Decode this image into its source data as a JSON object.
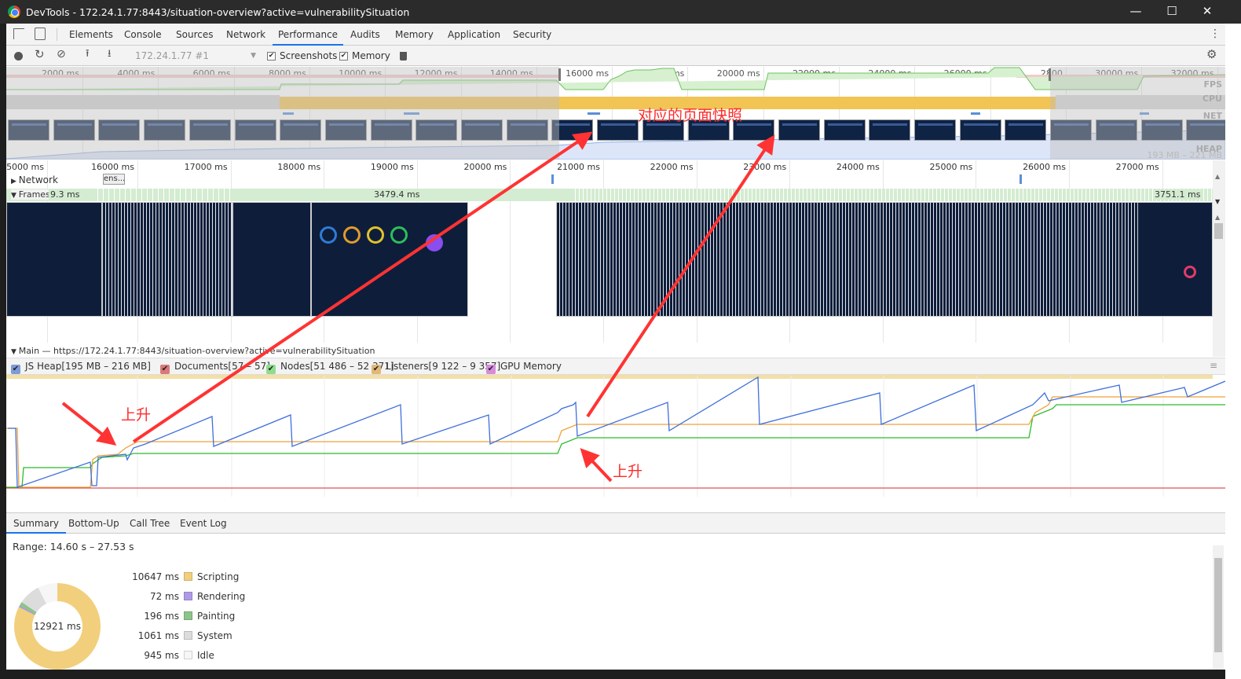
{
  "window": {
    "title": "DevTools - 172.24.1.77:8443/situation-overview?active=vulnerabilitySituation",
    "minimize": "—",
    "maximize": "☐",
    "close": "✕"
  },
  "tabs": [
    "Elements",
    "Console",
    "Sources",
    "Network",
    "Performance",
    "Audits",
    "Memory",
    "Application",
    "Security"
  ],
  "active_tab": "Performance",
  "toolbar": {
    "profile_select": "172.24.1.77 #1",
    "screenshots_label": "Screenshots",
    "screenshots_checked": true,
    "memory_label": "Memory",
    "memory_checked": true
  },
  "overview": {
    "ticks": [
      "2000 ms",
      "4000 ms",
      "6000 ms",
      "8000 ms",
      "10000 ms",
      "12000 ms",
      "14000 ms",
      "16000 ms",
      "18000 ms",
      "20000 ms",
      "22000 ms",
      "24000 ms",
      "26000 ms",
      "2800",
      "30000 ms",
      "32000 ms"
    ],
    "lanes": {
      "fps": "FPS",
      "cpu": "CPU",
      "net": "NET",
      "heap": "HEAP"
    },
    "heap_range": "193 MB – 221 MB"
  },
  "detail": {
    "ticks": [
      "5000 ms",
      "16000 ms",
      "17000 ms",
      "18000 ms",
      "19000 ms",
      "20000 ms",
      "21000 ms",
      "22000 ms",
      "23000 ms",
      "24000 ms",
      "25000 ms",
      "26000 ms",
      "27000 ms"
    ],
    "network_label": "Network",
    "network_item": "ens...",
    "frames_label": "Frames",
    "frames_values": [
      "9.3 ms",
      "3479.4 ms",
      "3751.1 ms"
    ],
    "main_label": "Main — https://172.24.1.77:8443/situation-overview?active=vulnerabilitySituation"
  },
  "memory_legend": [
    {
      "label": "JS Heap[195 MB – 216 MB]",
      "color": "#7d9bd8",
      "line": "#3f6fdc"
    },
    {
      "label": "Documents[57 – 57]",
      "color": "#d97a7a",
      "line": "#d42a2a"
    },
    {
      "label": "Nodes[51 486 – 52 371]",
      "color": "#8fdc8f",
      "line": "#2dbb2d"
    },
    {
      "label": "Listeners[9 122 – 9 357]",
      "color": "#e0b878",
      "line": "#eea23a"
    },
    {
      "label": "GPU Memory",
      "color": "#d78bdb",
      "line": "#b050b8"
    }
  ],
  "bottom_tabs": [
    "Summary",
    "Bottom-Up",
    "Call Tree",
    "Event Log"
  ],
  "summary": {
    "range": "Range: 14.60 s – 27.53 s",
    "total": "12921 ms",
    "items": [
      {
        "value": "10647 ms",
        "ms": 10647,
        "label": "Scripting",
        "color": "#f2cf7c"
      },
      {
        "value": "72 ms",
        "ms": 72,
        "label": "Rendering",
        "color": "#af9ae6"
      },
      {
        "value": "196 ms",
        "ms": 196,
        "label": "Painting",
        "color": "#8dc48a"
      },
      {
        "value": "1061 ms",
        "ms": 1061,
        "label": "System",
        "color": "#dcdcdc"
      },
      {
        "value": "945 ms",
        "ms": 945,
        "label": "Idle",
        "color": "#f6f6f6"
      }
    ]
  },
  "annotations": {
    "rise1": "上升",
    "rise2": "上升",
    "snapshot": "对应的页面快照",
    "color": "#ff3333"
  }
}
